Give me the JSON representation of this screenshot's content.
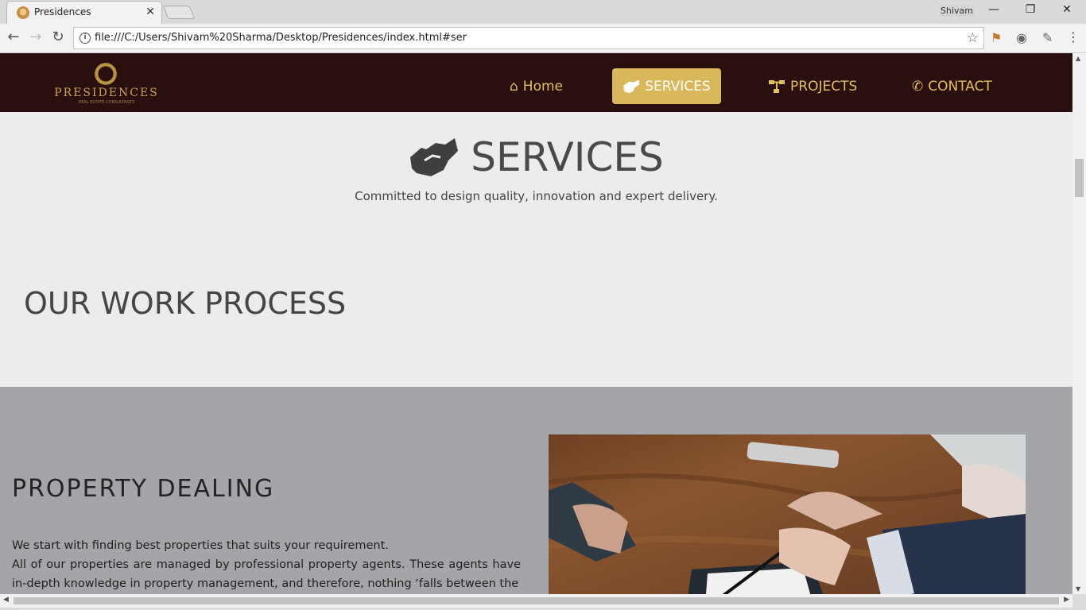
{
  "browser": {
    "tab_title": "Presidences",
    "tab_close": "✕",
    "profile_name": "Shivam",
    "url": "file:///C:/Users/Shivam%20Sharma/Desktop/Presidences/index.html#ser",
    "buttons": {
      "back": "←",
      "forward": "→",
      "reload": "↻",
      "minimize": "—",
      "maximize": "❐",
      "close": "✕",
      "star": "☆",
      "menu": "⋮",
      "info": "i"
    }
  },
  "site": {
    "logo_text": "PRESIDENCES",
    "logo_subtext": "REAL ESTATE CONSULTANTS",
    "nav": [
      {
        "label": "Home",
        "icon": "home-icon",
        "glyph": "⌂"
      },
      {
        "label": "SERVICES",
        "icon": "handshake-icon",
        "glyph": "🤝"
      },
      {
        "label": "PROJECTS",
        "icon": "sitemap-icon",
        "glyph": "⛬"
      },
      {
        "label": "CONTACT",
        "icon": "phone-icon",
        "glyph": "✆"
      }
    ],
    "colors": {
      "nav_bg": "#2a0f0f",
      "accent": "#d9b85c",
      "accent_text": "#e2c060",
      "band_bg": "#a3a5a8"
    }
  },
  "services": {
    "title": "SERVICES",
    "subtitle": "Committed to design quality, innovation and expert delivery."
  },
  "work_process": {
    "title": "OUR WORK PROCESS"
  },
  "property_dealing": {
    "title": "PROPERTY DEALING",
    "paragraph_1": "We start with finding best properties that suits your requirement.",
    "paragraph_2": "All of our properties are managed by professional property agents. These agents have in-depth knowledge in property management, and therefore, nothing ‘falls between the"
  }
}
